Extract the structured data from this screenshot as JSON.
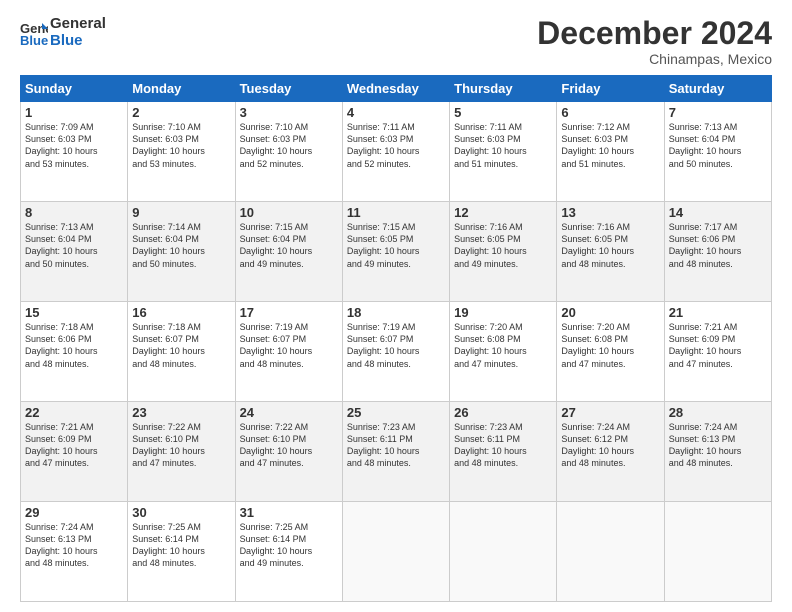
{
  "header": {
    "logo_line1": "General",
    "logo_line2": "Blue",
    "month": "December 2024",
    "location": "Chinampas, Mexico"
  },
  "weekdays": [
    "Sunday",
    "Monday",
    "Tuesday",
    "Wednesday",
    "Thursday",
    "Friday",
    "Saturday"
  ],
  "weeks": [
    [
      {
        "day": "1",
        "info": "Sunrise: 7:09 AM\nSunset: 6:03 PM\nDaylight: 10 hours\nand 53 minutes."
      },
      {
        "day": "2",
        "info": "Sunrise: 7:10 AM\nSunset: 6:03 PM\nDaylight: 10 hours\nand 53 minutes."
      },
      {
        "day": "3",
        "info": "Sunrise: 7:10 AM\nSunset: 6:03 PM\nDaylight: 10 hours\nand 52 minutes."
      },
      {
        "day": "4",
        "info": "Sunrise: 7:11 AM\nSunset: 6:03 PM\nDaylight: 10 hours\nand 52 minutes."
      },
      {
        "day": "5",
        "info": "Sunrise: 7:11 AM\nSunset: 6:03 PM\nDaylight: 10 hours\nand 51 minutes."
      },
      {
        "day": "6",
        "info": "Sunrise: 7:12 AM\nSunset: 6:03 PM\nDaylight: 10 hours\nand 51 minutes."
      },
      {
        "day": "7",
        "info": "Sunrise: 7:13 AM\nSunset: 6:04 PM\nDaylight: 10 hours\nand 50 minutes."
      }
    ],
    [
      {
        "day": "8",
        "info": "Sunrise: 7:13 AM\nSunset: 6:04 PM\nDaylight: 10 hours\nand 50 minutes."
      },
      {
        "day": "9",
        "info": "Sunrise: 7:14 AM\nSunset: 6:04 PM\nDaylight: 10 hours\nand 50 minutes."
      },
      {
        "day": "10",
        "info": "Sunrise: 7:15 AM\nSunset: 6:04 PM\nDaylight: 10 hours\nand 49 minutes."
      },
      {
        "day": "11",
        "info": "Sunrise: 7:15 AM\nSunset: 6:05 PM\nDaylight: 10 hours\nand 49 minutes."
      },
      {
        "day": "12",
        "info": "Sunrise: 7:16 AM\nSunset: 6:05 PM\nDaylight: 10 hours\nand 49 minutes."
      },
      {
        "day": "13",
        "info": "Sunrise: 7:16 AM\nSunset: 6:05 PM\nDaylight: 10 hours\nand 48 minutes."
      },
      {
        "day": "14",
        "info": "Sunrise: 7:17 AM\nSunset: 6:06 PM\nDaylight: 10 hours\nand 48 minutes."
      }
    ],
    [
      {
        "day": "15",
        "info": "Sunrise: 7:18 AM\nSunset: 6:06 PM\nDaylight: 10 hours\nand 48 minutes."
      },
      {
        "day": "16",
        "info": "Sunrise: 7:18 AM\nSunset: 6:07 PM\nDaylight: 10 hours\nand 48 minutes."
      },
      {
        "day": "17",
        "info": "Sunrise: 7:19 AM\nSunset: 6:07 PM\nDaylight: 10 hours\nand 48 minutes."
      },
      {
        "day": "18",
        "info": "Sunrise: 7:19 AM\nSunset: 6:07 PM\nDaylight: 10 hours\nand 48 minutes."
      },
      {
        "day": "19",
        "info": "Sunrise: 7:20 AM\nSunset: 6:08 PM\nDaylight: 10 hours\nand 47 minutes."
      },
      {
        "day": "20",
        "info": "Sunrise: 7:20 AM\nSunset: 6:08 PM\nDaylight: 10 hours\nand 47 minutes."
      },
      {
        "day": "21",
        "info": "Sunrise: 7:21 AM\nSunset: 6:09 PM\nDaylight: 10 hours\nand 47 minutes."
      }
    ],
    [
      {
        "day": "22",
        "info": "Sunrise: 7:21 AM\nSunset: 6:09 PM\nDaylight: 10 hours\nand 47 minutes."
      },
      {
        "day": "23",
        "info": "Sunrise: 7:22 AM\nSunset: 6:10 PM\nDaylight: 10 hours\nand 47 minutes."
      },
      {
        "day": "24",
        "info": "Sunrise: 7:22 AM\nSunset: 6:10 PM\nDaylight: 10 hours\nand 47 minutes."
      },
      {
        "day": "25",
        "info": "Sunrise: 7:23 AM\nSunset: 6:11 PM\nDaylight: 10 hours\nand 48 minutes."
      },
      {
        "day": "26",
        "info": "Sunrise: 7:23 AM\nSunset: 6:11 PM\nDaylight: 10 hours\nand 48 minutes."
      },
      {
        "day": "27",
        "info": "Sunrise: 7:24 AM\nSunset: 6:12 PM\nDaylight: 10 hours\nand 48 minutes."
      },
      {
        "day": "28",
        "info": "Sunrise: 7:24 AM\nSunset: 6:13 PM\nDaylight: 10 hours\nand 48 minutes."
      }
    ],
    [
      {
        "day": "29",
        "info": "Sunrise: 7:24 AM\nSunset: 6:13 PM\nDaylight: 10 hours\nand 48 minutes."
      },
      {
        "day": "30",
        "info": "Sunrise: 7:25 AM\nSunset: 6:14 PM\nDaylight: 10 hours\nand 48 minutes."
      },
      {
        "day": "31",
        "info": "Sunrise: 7:25 AM\nSunset: 6:14 PM\nDaylight: 10 hours\nand 49 minutes."
      },
      {
        "day": "",
        "info": ""
      },
      {
        "day": "",
        "info": ""
      },
      {
        "day": "",
        "info": ""
      },
      {
        "day": "",
        "info": ""
      }
    ]
  ]
}
